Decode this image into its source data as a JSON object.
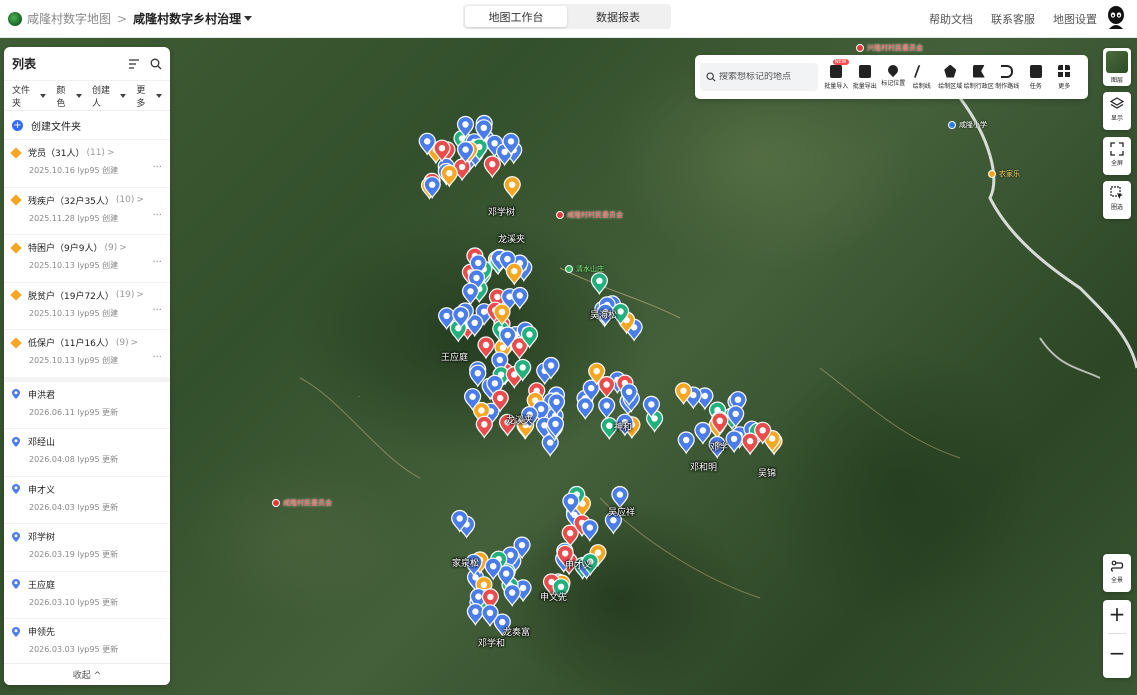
{
  "breadcrumb": {
    "root": "咸隆村数字地图",
    "current": "咸隆村数字乡村治理"
  },
  "mode_tabs": [
    {
      "label": "地图工作台",
      "active": true
    },
    {
      "label": "数据报表",
      "active": false
    }
  ],
  "top_links": [
    "帮助文档",
    "联系客服",
    "地图设置"
  ],
  "panel": {
    "title": "列表",
    "filters": [
      "文件夹",
      "颜色",
      "创建人",
      "更多"
    ],
    "create_folder": "创建文件夹",
    "folders": [
      {
        "name": "党员（31人）",
        "count": "(11)",
        "meta": "2025.10.16 lyp95 创建"
      },
      {
        "name": "残疾户（32户35人）",
        "count": "(10)",
        "meta": "2025.11.28 lyp95 创建"
      },
      {
        "name": "特困户（9户9人）",
        "count": "(9)",
        "meta": "2025.10.13 lyp95 创建"
      },
      {
        "name": "脱贫户（19户72人）",
        "count": "(19)",
        "meta": "2025.10.13 lyp95 创建"
      },
      {
        "name": "低保户（11户16人）",
        "count": "(9)",
        "meta": "2025.10.13 lyp95 创建"
      }
    ],
    "places": [
      {
        "name": "申洪君",
        "meta": "2026.06.11 lyp95 更新"
      },
      {
        "name": "邓经山",
        "meta": "2026.04.08 lyp95 更新"
      },
      {
        "name": "申才义",
        "meta": "2026.04.03 lyp95 更新"
      },
      {
        "name": "邓学树",
        "meta": "2026.03.19 lyp95 更新"
      },
      {
        "name": "王应庭",
        "meta": "2026.03.10 lyp95 更新"
      },
      {
        "name": "申领先",
        "meta": "2026.03.03 lyp95 更新"
      }
    ],
    "collapse": "收起 ^"
  },
  "toolbar": {
    "search_placeholder": "搜索想标记的地点",
    "new_badge": "NEW",
    "tools": [
      "批量导入",
      "批量导出",
      "标记位置",
      "绘制线",
      "绘制区域",
      "绘制行政区",
      "制作路线",
      "任务",
      "更多"
    ]
  },
  "right_controls": {
    "layers": "图层",
    "display": "显示",
    "fullscreen": "全屏",
    "select": "圈选",
    "route": "全景"
  },
  "pois": [
    {
      "label": "咸隆村村民委员会",
      "type": "red"
    },
    {
      "label": "兴隆村村民委员会",
      "type": "red"
    },
    {
      "label": "咸隆村民委员会",
      "type": "red"
    },
    {
      "label": "咸隆小学",
      "type": "blue"
    },
    {
      "label": "农家乐",
      "type": "orange"
    },
    {
      "label": "清水山庄",
      "type": "green"
    }
  ],
  "marker_labels": [
    "龙溪夹",
    "龙溪夹",
    "邓学",
    "王应庭",
    "吴海松",
    "神和",
    "邓和明",
    "邓学树",
    "吴应祥",
    "申文先",
    "家泉松",
    "申才义",
    "邓学和",
    "龙奏富",
    "吴锦"
  ],
  "colors": {
    "accent": "#2f6bff",
    "pin_blue": "#4a7dea",
    "pin_red": "#e84c4c",
    "pin_green": "#22b07d",
    "pin_orange": "#f5a623"
  }
}
